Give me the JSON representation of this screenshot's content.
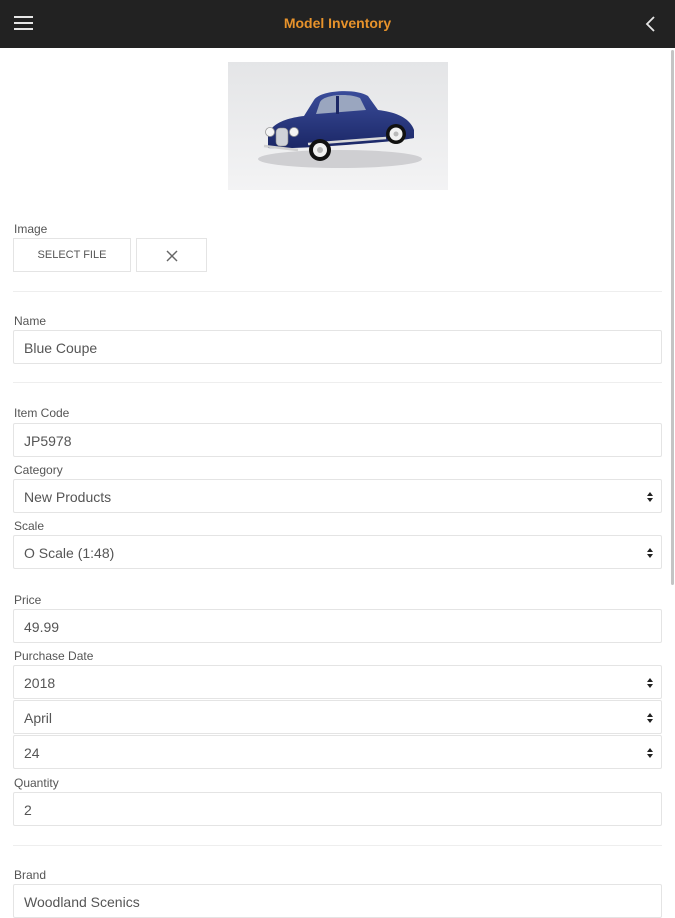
{
  "header": {
    "title": "Model Inventory",
    "menu_icon": "hamburger-menu-icon",
    "back_icon": "chevron-left-icon",
    "accent_color": "#e8932b",
    "background_color": "#222222"
  },
  "image_section": {
    "label": "Image",
    "select_file_label": "SELECT FILE",
    "clear_icon": "close-icon"
  },
  "name": {
    "label": "Name",
    "value": "Blue Coupe"
  },
  "item_code": {
    "label": "Item Code",
    "value": "JP5978"
  },
  "category": {
    "label": "Category",
    "value": "New Products"
  },
  "scale": {
    "label": "Scale",
    "value": "O Scale (1:48)"
  },
  "price": {
    "label": "Price",
    "value": "49.99"
  },
  "purchase_date": {
    "label": "Purchase Date",
    "year": "2018",
    "month": "April",
    "day": "24"
  },
  "quantity": {
    "label": "Quantity",
    "value": "2"
  },
  "brand": {
    "label": "Brand",
    "value": "Woodland Scenics"
  }
}
